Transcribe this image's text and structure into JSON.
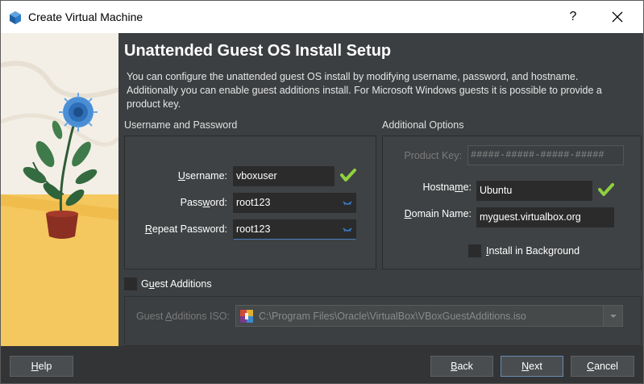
{
  "window": {
    "title": "Create Virtual Machine",
    "help_glyph": "?"
  },
  "page": {
    "heading": "Unattended Guest OS Install Setup",
    "description": "You can configure the unattended guest OS install by modifying username, password, and hostname. Additionally you can enable guest additions install. For Microsoft Windows guests it is possible to provide a product key."
  },
  "user_group": {
    "title": "Username and Password",
    "username_label": "Username:",
    "username_value": "vboxuser",
    "password_label": "Password:",
    "password_value": "root123",
    "repeat_label": "Repeat Password:",
    "repeat_value": "root123"
  },
  "options_group": {
    "title": "Additional Options",
    "product_key_label": "Product Key:",
    "product_key_value": "#####-#####-#####-#####",
    "hostname_label": "Hostname:",
    "hostname_value": "Ubuntu",
    "domain_label": "Domain Name:",
    "domain_value": "myguest.virtualbox.org",
    "install_bg_label": "Install in Background",
    "install_bg_checked": false
  },
  "guest_additions": {
    "label": "Guest Additions",
    "checked": false,
    "iso_label": "Guest Additions ISO:",
    "iso_value": "C:\\Program Files\\Oracle\\VirtualBox\\VBoxGuestAdditions.iso"
  },
  "footer": {
    "help": "Help",
    "back": "Back",
    "next": "Next",
    "cancel": "Cancel"
  },
  "colors": {
    "accent_check": "#8fd13f",
    "panel_bg": "#3c3f41",
    "field_bg": "#2b2b2b"
  },
  "icons": [
    "virtualbox-icon",
    "close-icon",
    "checkmark-icon",
    "eye-icon",
    "iso-disc-icon",
    "dropdown-arrow-icon"
  ]
}
